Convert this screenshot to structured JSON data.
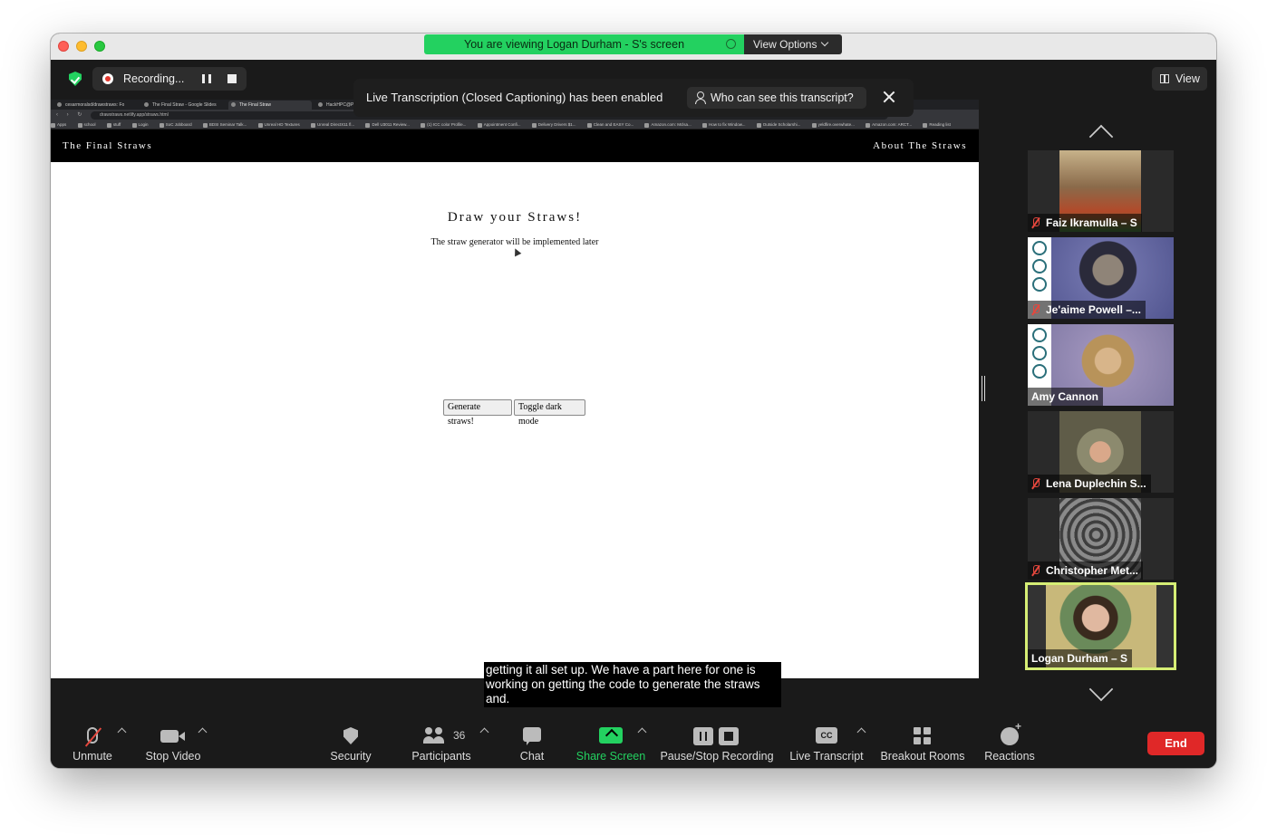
{
  "title_bar": {
    "viewing_text": "You are viewing Logan Durham - S's screen",
    "view_options": "View Options"
  },
  "top_bar": {
    "recording_label": "Recording...",
    "view_label": "View"
  },
  "transcription_banner": {
    "message": "Live Transcription (Closed Captioning) has been enabled",
    "who_button": "Who can see this transcript?"
  },
  "browser": {
    "tabs": [
      "cesarmoralsd/drawstraws: Fo",
      "The Final Straw - Google Slides",
      "The Final Straw",
      "HackHPC@PE"
    ],
    "url": "drawstraws.netlify.app/straws.html",
    "bookmarks": [
      "Apps",
      "school",
      "stuff",
      "Login",
      "SoC Jobboard",
      "BDSI Seminar Talk...",
      "Unreal HD Textures",
      "Unreal DirectX11 fl...",
      "Dell U3011 Review...",
      "(1) ICC color Profile...",
      "Appointment Confi...",
      "Delivery Drivers $1...",
      "Clean and EASY Co...",
      "Amazon.com: Mclsa...",
      "How to fix Window...",
      "Outside Scholarshi...",
      "yeldfire.overwhate...",
      "Amazon.com: ARCT...",
      "Reading list"
    ],
    "site": {
      "brand": "The Final Straws",
      "about": "About The Straws",
      "heading": "Draw your Straws!",
      "subtitle": "The straw generator will be implemented later",
      "generate_button": "Generate straws!",
      "dark_button": "Toggle dark mode"
    }
  },
  "caption": "getting it all set up. We have a part here for one is working on getting the code to generate the straws and.",
  "participants_gallery": [
    {
      "name": "Faiz Ikramulla – S",
      "muted": true,
      "photo_color": "#8a6a4a"
    },
    {
      "name": "Je'aime Powell –...",
      "muted": true,
      "photo_color": "#6c6fa8"
    },
    {
      "name": "Amy Cannon",
      "muted": false,
      "photo_color": "#9a8fb8"
    },
    {
      "name": "Lena Duplechin S...",
      "muted": true,
      "photo_color": "#7b7a5f"
    },
    {
      "name": "Christopher Met...",
      "muted": true,
      "photo_color": "#6b6b6b"
    },
    {
      "name": "Logan Durham – S",
      "muted": false,
      "photo_color": "#4a3a2a",
      "active_speaker": true
    }
  ],
  "toolbar": {
    "unmute": "Unmute",
    "stop_video": "Stop Video",
    "security": "Security",
    "participants": "Participants",
    "participant_count": "36",
    "chat": "Chat",
    "share_screen": "Share Screen",
    "pause_stop_recording": "Pause/Stop Recording",
    "live_transcript": "Live Transcript",
    "cc_glyph": "CC",
    "breakout_rooms": "Breakout Rooms",
    "reactions": "Reactions",
    "end": "End"
  },
  "colors": {
    "share_green": "#23d160",
    "end_red": "#e02828",
    "active_speaker_border": "#d6ee75"
  }
}
